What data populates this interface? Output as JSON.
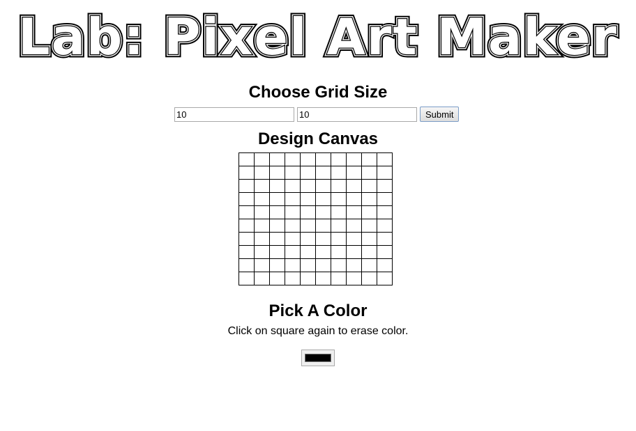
{
  "page": {
    "title": "Lab: Pixel Art Maker"
  },
  "size_form": {
    "heading": "Choose Grid Size",
    "height_value": "10",
    "width_value": "10",
    "submit_label": "Submit"
  },
  "canvas": {
    "heading": "Design Canvas",
    "rows": 10,
    "cols": 10
  },
  "color": {
    "heading": "Pick A Color",
    "hint": "Click on square again to erase color.",
    "value": "#000000"
  }
}
